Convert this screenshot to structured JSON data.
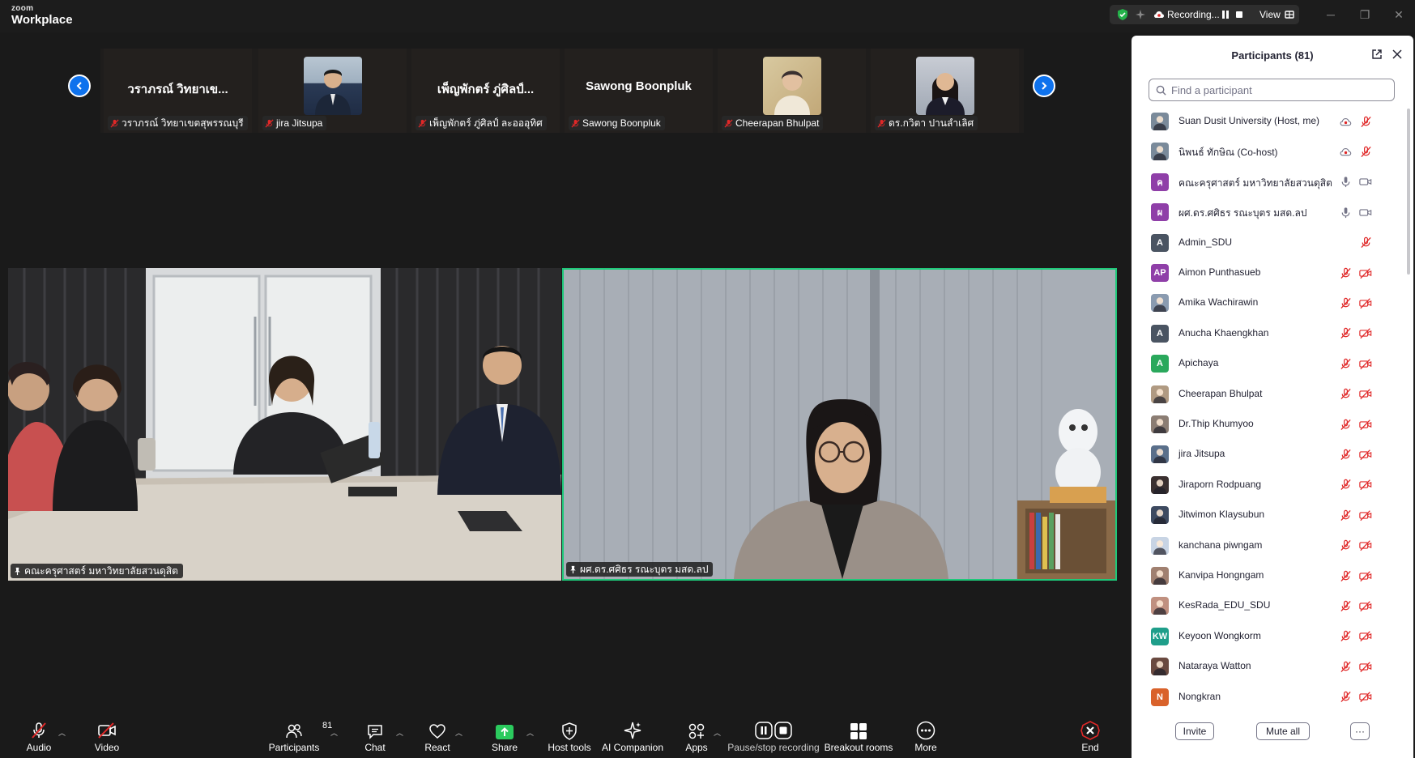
{
  "titlebar": {
    "brand_top": "zoom",
    "brand_bottom": "Workplace",
    "recording_label": "Recording...",
    "view_label": "View"
  },
  "gallery": [
    {
      "big_name": "วราภรณ์  วิทยาเข...",
      "label": "วราภรณ์  วิทยาเขตสุพรรณบุรี",
      "photo": false
    },
    {
      "big_name": "",
      "label": "jira Jitsupa",
      "photo": true
    },
    {
      "big_name": "เพ็ญพักตร์ ภู่ศิลป์...",
      "label": "เพ็ญพักตร์ ภู่ศิลป์ ละอออุทิศ",
      "photo": false
    },
    {
      "big_name": "Sawong Boonpluk",
      "label": "Sawong Boonpluk",
      "photo": false
    },
    {
      "big_name": "",
      "label": "Cheerapan Bhulpat",
      "photo": true
    },
    {
      "big_name": "",
      "label": "ดร.กวิตา ปานลำเลิศ",
      "photo": true
    }
  ],
  "videos": {
    "left_label": "คณะครุศาสตร์ มหาวิทยาลัยสวนดุสิต",
    "right_label": "ผศ.ดร.ศศิธร รณะบุตร มสด.ลป"
  },
  "toolbar": {
    "audio": "Audio",
    "video": "Video",
    "participants": "Participants",
    "participants_count": "81",
    "chat": "Chat",
    "react": "React",
    "share": "Share",
    "host_tools": "Host tools",
    "ai_companion": "AI Companion",
    "apps": "Apps",
    "pause_stop": "Pause/stop recording",
    "breakout": "Breakout rooms",
    "more": "More",
    "end": "End"
  },
  "panel": {
    "title": "Participants (81)",
    "search_placeholder": "Find a participant",
    "invite": "Invite",
    "mute_all": "Mute all",
    "more": "···",
    "participants": [
      {
        "name": "Suan Dusit University (Host, me)",
        "avatar": "photo",
        "color": "#7a8a9a",
        "mic": "muted",
        "video": "cloud"
      },
      {
        "name": "นิพนธ์ ทักษิณ (Co-host)",
        "avatar": "photo",
        "color": "#7a8a9a",
        "mic": "muted",
        "video": "cloud"
      },
      {
        "name": "คณะครุศาสตร์ มหาวิทยาลัยสวนดุสิต",
        "avatar": "ค",
        "color": "#8f3fa8",
        "mic": "on",
        "video": "on"
      },
      {
        "name": "ผศ.ดร.ศศิธร รณะบุตร มสด.ลป",
        "avatar": "ผ",
        "color": "#8f3fa8",
        "mic": "on",
        "video": "on"
      },
      {
        "name": "Admin_SDU",
        "avatar": "A",
        "color": "#4a5462",
        "mic": "muted",
        "video": "none"
      },
      {
        "name": "Aimon Punthasueb",
        "avatar": "AP",
        "color": "#8f3fa8",
        "mic": "muted",
        "video": "off"
      },
      {
        "name": "Amika Wachirawin",
        "avatar": "photo",
        "color": "#8a9bb0",
        "mic": "muted",
        "video": "off"
      },
      {
        "name": "Anucha Khaengkhan",
        "avatar": "A",
        "color": "#4a5462",
        "mic": "muted",
        "video": "off"
      },
      {
        "name": "Apichaya",
        "avatar": "A",
        "color": "#2aa85c",
        "mic": "muted",
        "video": "off"
      },
      {
        "name": "Cheerapan Bhulpat",
        "avatar": "photo",
        "color": "#b09a82",
        "mic": "muted",
        "video": "off"
      },
      {
        "name": "Dr.Thip Khumyoo",
        "avatar": "photo",
        "color": "#8b7d73",
        "mic": "muted",
        "video": "off"
      },
      {
        "name": "jira Jitsupa",
        "avatar": "photo",
        "color": "#5a6f8a",
        "mic": "muted",
        "video": "off"
      },
      {
        "name": "Jiraporn Rodpuang",
        "avatar": "photo",
        "color": "#3a3030",
        "mic": "muted",
        "video": "off"
      },
      {
        "name": "Jitwimon Klaysubun",
        "avatar": "photo",
        "color": "#3d4a60",
        "mic": "muted",
        "video": "off"
      },
      {
        "name": "kanchana piwngam",
        "avatar": "photo",
        "color": "#c8d4e4",
        "mic": "muted",
        "video": "off"
      },
      {
        "name": "Kanvipa Hongngam",
        "avatar": "photo",
        "color": "#a08070",
        "mic": "muted",
        "video": "off"
      },
      {
        "name": "KesRada_EDU_SDU",
        "avatar": "photo",
        "color": "#c09080",
        "mic": "muted",
        "video": "off"
      },
      {
        "name": "Keyoon Wongkorm",
        "avatar": "KW",
        "color": "#1f9e8a",
        "mic": "muted",
        "video": "off"
      },
      {
        "name": "Nataraya Watton",
        "avatar": "photo",
        "color": "#6a4a40",
        "mic": "muted",
        "video": "off"
      },
      {
        "name": "Nongkran",
        "avatar": "N",
        "color": "#d9622b",
        "mic": "muted",
        "video": "off"
      }
    ]
  },
  "colors": {
    "accent_blue": "#0e72ed",
    "active_speaker": "#1ec97a",
    "mute_red": "#e02828",
    "share_green": "#2bcb5e"
  }
}
